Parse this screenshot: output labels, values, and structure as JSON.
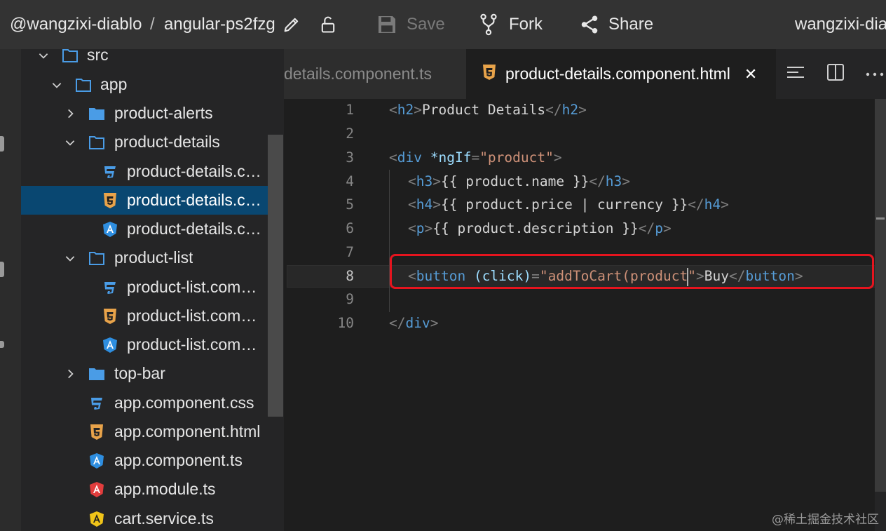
{
  "topbar": {
    "user": "@wangzixi-diablo",
    "separator": "/",
    "project": "angular-ps2fzg",
    "save_label": "Save",
    "fork_label": "Fork",
    "share_label": "Share",
    "owner": "wangzixi-dia",
    "icons": [
      "pencil-icon",
      "unlock-icon",
      "save-disk-icon",
      "fork-icon",
      "share-icon"
    ]
  },
  "sidebar": {
    "items": [
      {
        "label": "src",
        "kind": "folder-open"
      },
      {
        "label": "app",
        "kind": "folder-open"
      },
      {
        "label": "product-alerts",
        "kind": "folder-closed"
      },
      {
        "label": "product-details",
        "kind": "folder-open"
      },
      {
        "label": "product-details.component.css",
        "kind": "css"
      },
      {
        "label": "product-details.component.html",
        "kind": "html",
        "selected": true
      },
      {
        "label": "product-details.component.ts",
        "kind": "angular"
      },
      {
        "label": "product-list",
        "kind": "folder-open"
      },
      {
        "label": "product-list.component.css",
        "kind": "css"
      },
      {
        "label": "product-list.component.html",
        "kind": "html"
      },
      {
        "label": "product-list.component.ts",
        "kind": "angular"
      },
      {
        "label": "top-bar",
        "kind": "folder-closed"
      },
      {
        "label": "app.component.css",
        "kind": "css"
      },
      {
        "label": "app.component.html",
        "kind": "html"
      },
      {
        "label": "app.component.ts",
        "kind": "angular"
      },
      {
        "label": "app.module.ts",
        "kind": "angular-module"
      },
      {
        "label": "cart.service.ts",
        "kind": "angular-service"
      }
    ]
  },
  "tabs": [
    {
      "label": "details.component.ts",
      "active": false
    },
    {
      "label": "product-details.component.html",
      "active": true,
      "close": "✕"
    }
  ],
  "editor": {
    "line_numbers": [
      "1",
      "2",
      "3",
      "4",
      "5",
      "6",
      "7",
      "8",
      "9",
      "10"
    ],
    "active_line": 8,
    "tokens": {
      "l1": [
        "<",
        "h2",
        ">",
        "Product Details",
        "</",
        "h2",
        ">"
      ],
      "l3": [
        "<",
        "div",
        " ",
        "*ngIf",
        "=",
        "\"product\"",
        ">"
      ],
      "l4": [
        "<",
        "h3",
        ">",
        "{{ product.name }}",
        "</",
        "h3",
        ">"
      ],
      "l5": [
        "<",
        "h4",
        ">",
        "{{ product.price | currency }}",
        "</",
        "h4",
        ">"
      ],
      "l6": [
        "<",
        "p",
        ">",
        "{{ product.description }}",
        "</",
        "p",
        ">"
      ],
      "l8": [
        "<",
        "button",
        " ",
        "(click)",
        "=",
        "\"addToCart(product",
        "\"",
        ">",
        "Buy",
        "</",
        "button",
        ">"
      ],
      "l10": [
        "</",
        "div",
        ">"
      ]
    }
  },
  "watermark": "@稀土掘金技术社区",
  "colors": {
    "selection": "#094771",
    "highlight_box": "#e5141e",
    "tag": "#569cd6",
    "attr": "#9cdcfe",
    "string": "#ce9178",
    "css_icon": "#4a9ce6",
    "html_icon": "#e8a34a",
    "angular_icon": "#2e8ee0",
    "angular_module_icon": "#e23d3d",
    "angular_service_icon": "#f0c419"
  }
}
